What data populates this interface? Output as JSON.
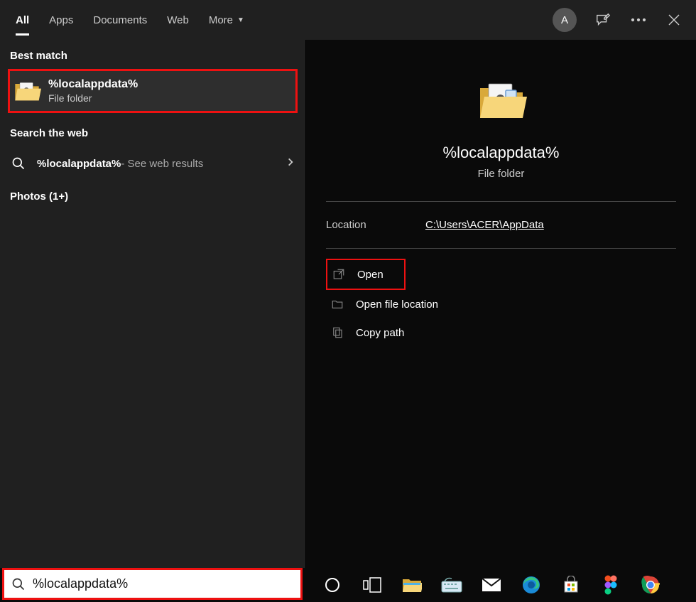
{
  "topbar": {
    "tabs": [
      "All",
      "Apps",
      "Documents",
      "Web",
      "More"
    ],
    "active_index": 0,
    "avatar_letter": "A"
  },
  "left": {
    "best_match_label": "Best match",
    "best_match": {
      "title": "%localappdata%",
      "subtitle": "File folder"
    },
    "search_web_label": "Search the web",
    "web_result": {
      "query": "%localappdata%",
      "suffix": " - See web results"
    },
    "photos_label": "Photos (1+)"
  },
  "detail": {
    "title": "%localappdata%",
    "subtitle": "File folder",
    "location_label": "Location",
    "location_value": "C:\\Users\\ACER\\AppData",
    "actions": {
      "open": "Open",
      "open_location": "Open file location",
      "copy_path": "Copy path"
    }
  },
  "search": {
    "value": "%localappdata%"
  }
}
